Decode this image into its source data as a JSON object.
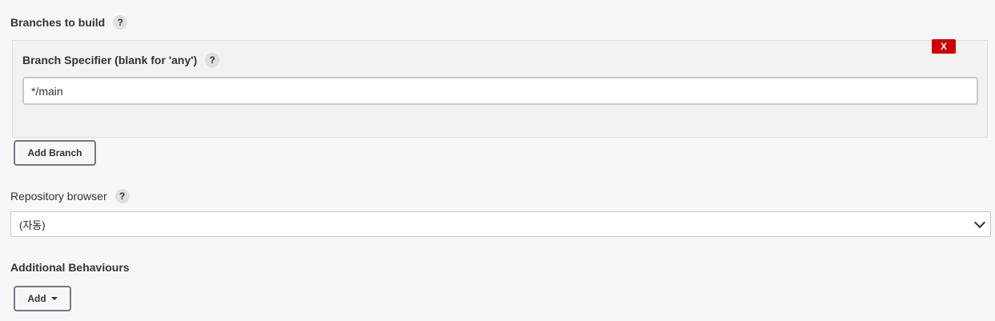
{
  "branches_section": {
    "title": "Branches to build",
    "help": "?"
  },
  "branch_entry": {
    "delete_label": "X",
    "specifier_label": "Branch Specifier (blank for 'any')",
    "help": "?",
    "specifier_value": "*/main"
  },
  "add_branch_label": "Add Branch",
  "repository_browser": {
    "label": "Repository browser",
    "help": "?",
    "selected": "(자동)"
  },
  "additional_behaviours": {
    "title": "Additional Behaviours",
    "add_label": "Add"
  },
  "colors": {
    "delete_red": "#cc0000",
    "background": "#f7f7f7",
    "button_border": "#6f7a86"
  }
}
